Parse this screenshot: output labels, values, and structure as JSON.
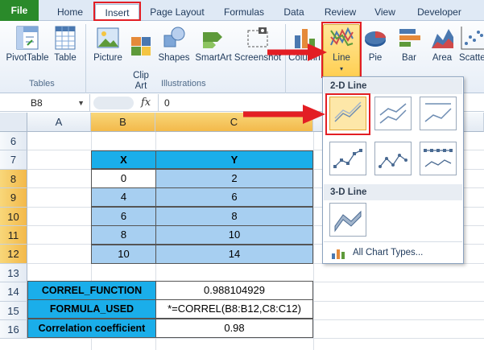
{
  "tabs": [
    "File",
    "Home",
    "Insert",
    "Page Layout",
    "Formulas",
    "Data",
    "Review",
    "View",
    "Developer"
  ],
  "ribbon": {
    "tables_group": {
      "label": "Tables",
      "buttons": [
        "PivotTable",
        "Table"
      ]
    },
    "illustrations_group": {
      "label": "Illustrations",
      "buttons": [
        "Picture",
        "Clip\nArt",
        "Shapes",
        "SmartArt",
        "Screenshot"
      ]
    },
    "chart_buttons": [
      "Column",
      "Line",
      "Pie",
      "Bar",
      "Area",
      "Scatter"
    ]
  },
  "formula_bar": {
    "name_box": "B8",
    "fx": "fx",
    "value": "0"
  },
  "columns": [
    "A",
    "B",
    "C"
  ],
  "rows": [
    "6",
    "7",
    "8",
    "9",
    "10",
    "11",
    "12",
    "13",
    "14",
    "15",
    "16"
  ],
  "table": {
    "headers": [
      "X",
      "Y"
    ],
    "rows": [
      [
        "0",
        "2"
      ],
      [
        "4",
        "6"
      ],
      [
        "6",
        "8"
      ],
      [
        "8",
        "10"
      ],
      [
        "10",
        "14"
      ]
    ]
  },
  "stats": [
    {
      "label": "CORREL_FUNCTION",
      "value": "0.988104929"
    },
    {
      "label": "FORMULA_USED",
      "value": "*=CORREL(B8:B12,C8:C12)"
    },
    {
      "label": "Correlation coefficient",
      "value": "0.98"
    }
  ],
  "dropdown": {
    "section_2d": "2-D Line",
    "section_3d": "3-D Line",
    "all_chart_types": "All Chart Types..."
  },
  "colors": {
    "file_tab": "#2a8a2a",
    "highlight": "#e31e24",
    "cyan": "#1aaeea",
    "light_blue": "#a7cff1"
  }
}
